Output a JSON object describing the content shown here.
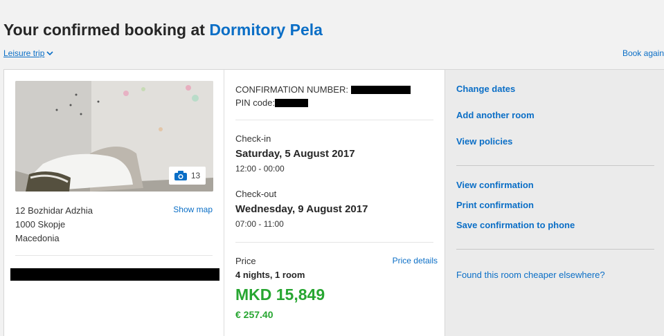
{
  "header": {
    "title_prefix": "Your confirmed booking at ",
    "hotel_name": "Dormitory Pela",
    "trip_type": "Leisure trip",
    "book_again": "Book again"
  },
  "property": {
    "photo_count": "13",
    "address": [
      "12 Bozhidar Adzhia",
      "1000 Skopje",
      "Macedonia"
    ],
    "show_map": "Show map"
  },
  "booking": {
    "confirmation_label": "CONFIRMATION NUMBER: ",
    "pin_label": "PIN code:",
    "checkin_label": "Check-in",
    "checkin_date": "Saturday, 5 August 2017",
    "checkin_time": "12:00 - 00:00",
    "checkout_label": "Check-out",
    "checkout_date": "Wednesday, 9 August 2017",
    "checkout_time": "07:00 - 11:00",
    "price_label": "Price",
    "price_details": "Price details",
    "stay_summary": "4 nights, 1 room",
    "price_local": "MKD 15,849",
    "price_eur": "€ 257.40"
  },
  "actions": {
    "change_dates": "Change dates",
    "add_room": "Add another room",
    "view_policies": "View policies",
    "view_confirmation": "View confirmation",
    "print_confirmation": "Print confirmation",
    "save_to_phone": "Save confirmation to phone",
    "found_cheaper": "Found this room cheaper elsewhere?"
  },
  "colors": {
    "link": "#0a6ec6",
    "price_green": "#27a631",
    "sidebar_bg": "#ebebeb"
  }
}
